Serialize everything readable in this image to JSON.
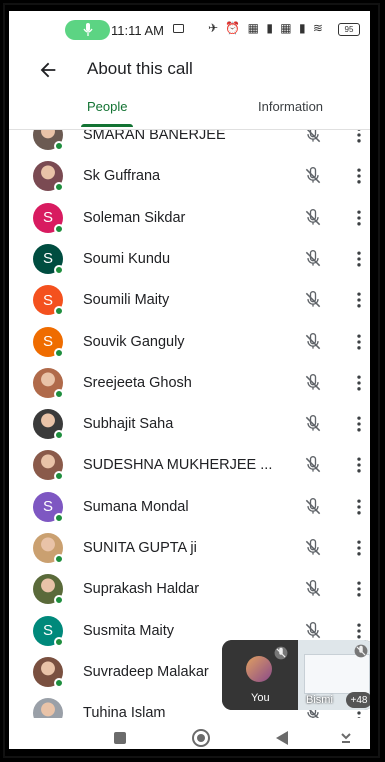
{
  "status_bar": {
    "time": "11:11 AM",
    "icons_text": "✈ ⏰ ▦ ▮ ▦ ▮ ≋",
    "battery": "95"
  },
  "header": {
    "title": "About this call"
  },
  "tabs": [
    {
      "label": "People",
      "active": true
    },
    {
      "label": "Information",
      "active": false
    }
  ],
  "participants": [
    {
      "name": "SMARAN BANERJEE",
      "avatar": "photo",
      "color": "#6b5a52"
    },
    {
      "name": "Sk Guffrana",
      "avatar": "photo",
      "color": "#7a4a52"
    },
    {
      "name": "Soleman Sikdar",
      "avatar": "S",
      "color": "#d81b60"
    },
    {
      "name": "Soumi Kundu",
      "avatar": "S",
      "color": "#004d40"
    },
    {
      "name": "Soumili Maity",
      "avatar": "S",
      "color": "#f4511e"
    },
    {
      "name": "Souvik Ganguly",
      "avatar": "S",
      "color": "#ef6c00"
    },
    {
      "name": "Sreejeeta Ghosh",
      "avatar": "photo",
      "color": "#b06a4a"
    },
    {
      "name": "Subhajit Saha",
      "avatar": "photo",
      "color": "#3a3a3a"
    },
    {
      "name": "SUDESHNA MUKHERJEE ...",
      "avatar": "photo",
      "color": "#8a5a4a"
    },
    {
      "name": "Sumana Mondal",
      "avatar": "S",
      "color": "#7e57c2"
    },
    {
      "name": "SUNITA GUPTA ji",
      "avatar": "photo",
      "color": "#caa070"
    },
    {
      "name": "Suprakash Haldar",
      "avatar": "photo",
      "color": "#5a6a3a"
    },
    {
      "name": "Susmita Maity",
      "avatar": "S",
      "color": "#00897b"
    },
    {
      "name": "Suvradeep Malakar",
      "avatar": "photo",
      "color": "#7a5040"
    },
    {
      "name": "Tuhina Islam",
      "avatar": "photo",
      "color": "#9aa0a8"
    }
  ],
  "pip": {
    "self_label": "You",
    "other_label": "Bismi",
    "extra_count": "+48"
  },
  "colors": {
    "accent": "#137333",
    "online": "#1e8e3e",
    "mic_pill": "#5cd483"
  }
}
